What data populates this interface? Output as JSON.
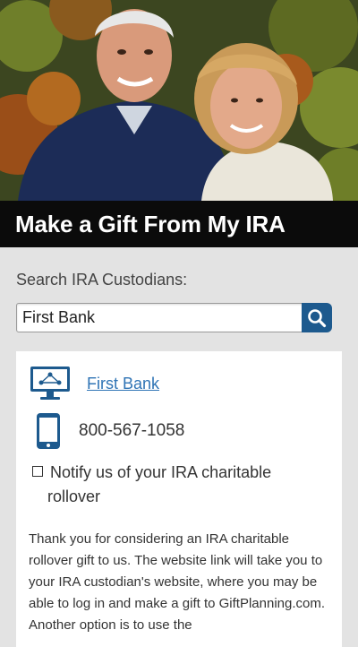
{
  "header": {
    "title": "Make a Gift From My IRA"
  },
  "search": {
    "label": "Search IRA Custodians:",
    "value": "First Bank",
    "button_icon": "search-icon"
  },
  "result": {
    "bank_name": "First Bank",
    "phone": "800-567-1058",
    "notify_line1": "Notify us of your IRA charitable",
    "notify_line2": "rollover",
    "description": "Thank you for considering an IRA charitable rollover gift to us. The website link will take you to your IRA custodian's website, where you may be able to log in and make a gift to GiftPlanning.com. Another option is to use the"
  },
  "colors": {
    "title_bar": "#0b0b0b",
    "search_button": "#1d5a8e",
    "link": "#2f74b5",
    "icon_blue": "#1d5a8e"
  }
}
